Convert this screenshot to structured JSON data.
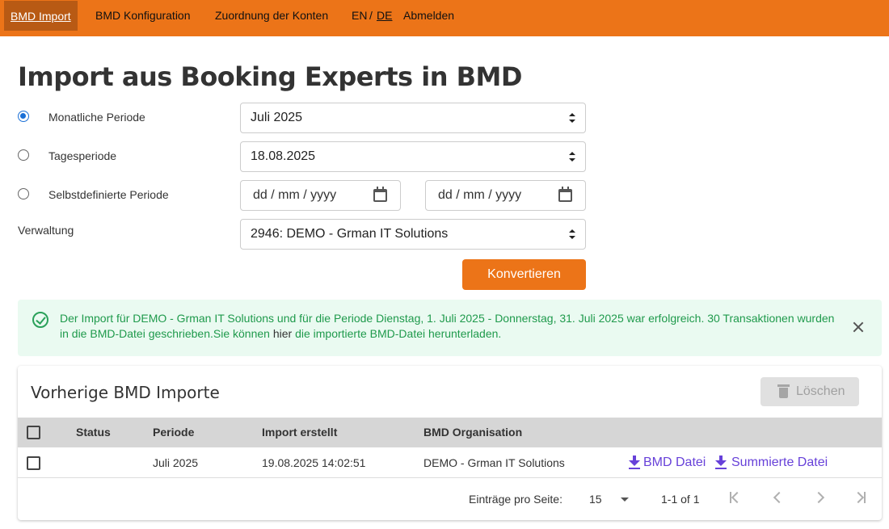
{
  "nav": {
    "items": [
      "BMD Import",
      "BMD Konfiguration",
      "Zuordnung der Konten"
    ],
    "lang_en": "EN",
    "lang_sep": "/",
    "lang_de": "DE",
    "logout": "Abmelden"
  },
  "page": {
    "title": "Import aus Booking Experts in BMD"
  },
  "form": {
    "period_options": [
      "Monatliche Periode",
      "Tagesperiode",
      "Selbstdefinierte Periode"
    ],
    "selected_period": "Monatliche Periode",
    "month_select": "Juli 2025",
    "day_select": "18.08.2025",
    "date_from_placeholder": "dd / mm / yyyy",
    "date_to_placeholder": "dd / mm / yyyy",
    "administration_label": "Verwaltung",
    "administration_select": "2946: DEMO - Grman IT Solutions",
    "convert_button": "Konvertieren"
  },
  "alert": {
    "text_part1": "Der Import für DEMO - Grman IT Solutions und für die Periode Dienstag, 1. Juli 2025 - Donnerstag, 31. Juli 2025 war erfolgreich. 30 Transaktionen wurden in die BMD-Datei geschrieben.Sie können",
    "text_plain": " hier ",
    "text_part2": "die importierte BMD-Datei herunterladen.",
    "color": "#1f9a4c"
  },
  "imports": {
    "title": "Vorherige BMD Importe",
    "delete_button": "Löschen",
    "columns": [
      "Status",
      "Periode",
      "Import erstellt",
      "BMD Organisation"
    ],
    "rows": [
      {
        "status": "",
        "period": "Juli 2025",
        "created": "19.08.2025 14:02:51",
        "organisation": "DEMO - Grman IT Solutions",
        "bmd_file": "BMD Datei",
        "summary_file": "Summierte Datei"
      }
    ],
    "pagination": {
      "per_page_label": "Einträge pro Seite:",
      "per_page": "15",
      "range": "1-1 of 1"
    }
  },
  "colors": {
    "brand": "#ec7418",
    "link": "#6741d9",
    "success": "#1f9a4c"
  }
}
